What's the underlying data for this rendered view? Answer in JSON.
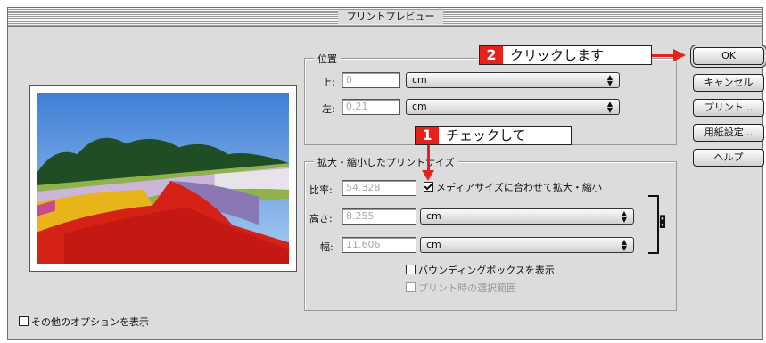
{
  "window": {
    "title": "プリントプレビュー"
  },
  "position_group": {
    "title": "位置",
    "top_label": "上:",
    "top_value": "0",
    "top_unit": "cm",
    "left_label": "左:",
    "left_value": "0.21",
    "left_unit": "cm"
  },
  "scale_group": {
    "title": "拡大・縮小したプリントサイズ",
    "scale_label": "比率:",
    "scale_value": "54.328",
    "fit_media_label": "メディアサイズに合わせて拡大・縮小",
    "fit_media_checked": true,
    "height_label": "高さ:",
    "height_value": "8.255",
    "height_unit": "cm",
    "width_label": "幅:",
    "width_value": "11.606",
    "width_unit": "cm",
    "bounding_box_label": "バウンディングボックスを表示",
    "print_selected_label": "プリント時の選択範囲"
  },
  "buttons": {
    "ok": "OK",
    "cancel": "キャンセル",
    "print": "プリント...",
    "page_setup": "用紙設定...",
    "help": "ヘルプ"
  },
  "show_more_options_label": "その他のオプションを表示",
  "callouts": {
    "step1_number": "1",
    "step1_text": "チェックして",
    "step2_number": "2",
    "step2_text": "クリックします"
  },
  "colors": {
    "callout_red": "#e8201a",
    "dialog_bg": "#dcdcdc"
  },
  "icons": [
    "popup-arrows-icon",
    "link-chain-icon",
    "checkbox-icon"
  ]
}
